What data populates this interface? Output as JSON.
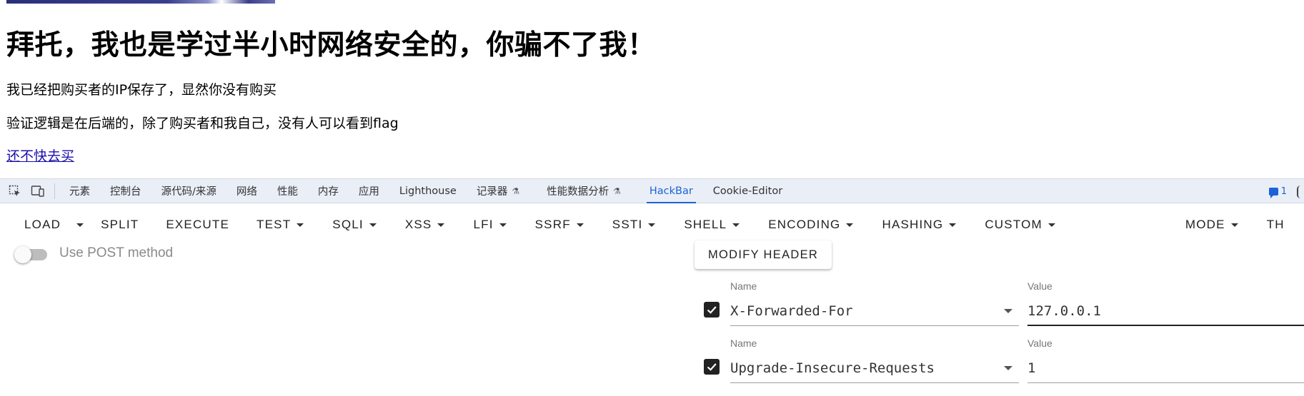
{
  "page": {
    "title": "拜托，我也是学过半小时网络安全的，你骗不了我！",
    "para1": "我已经把购买者的IP保存了，显然你没有购买",
    "para2": "验证逻辑是在后端的，除了购买者和我自己，没有人可以看到flag",
    "link": "还不快去买"
  },
  "devtools": {
    "tabs": [
      "元素",
      "控制台",
      "源代码/来源",
      "网络",
      "性能",
      "内存",
      "应用",
      "Lighthouse",
      "记录器",
      "性能数据分析",
      "HackBar",
      "Cookie-Editor"
    ],
    "active_tab": "HackBar",
    "message_count": "1",
    "icons": [
      "inspect-element-icon",
      "device-toolbar-icon",
      "flask-icon",
      "message-icon",
      "gear-icon"
    ]
  },
  "hackbar": {
    "load": "LOAD",
    "split": "SPLIT",
    "execute": "EXECUTE",
    "menus": [
      "TEST",
      "SQLI",
      "XSS",
      "LFI",
      "SSRF",
      "SSTI",
      "SHELL",
      "ENCODING",
      "HASHING",
      "CUSTOM"
    ],
    "mode": "MODE",
    "theme_partial": "TH",
    "post_toggle_label": "Use POST method",
    "post_enabled": false,
    "modify_header_label": "MODIFY HEADER",
    "headers": [
      {
        "checked": true,
        "name_label": "Name",
        "name": "X-Forwarded-For",
        "value_label": "Value",
        "value": "127.0.0.1"
      },
      {
        "checked": true,
        "name_label": "Name",
        "name": "Upgrade-Insecure-Requests",
        "value_label": "Value",
        "value": "1"
      }
    ]
  },
  "colors": {
    "link": "#1a0dab",
    "active_tab": "#1a63d8",
    "devtools_bg": "#eaeef7"
  }
}
